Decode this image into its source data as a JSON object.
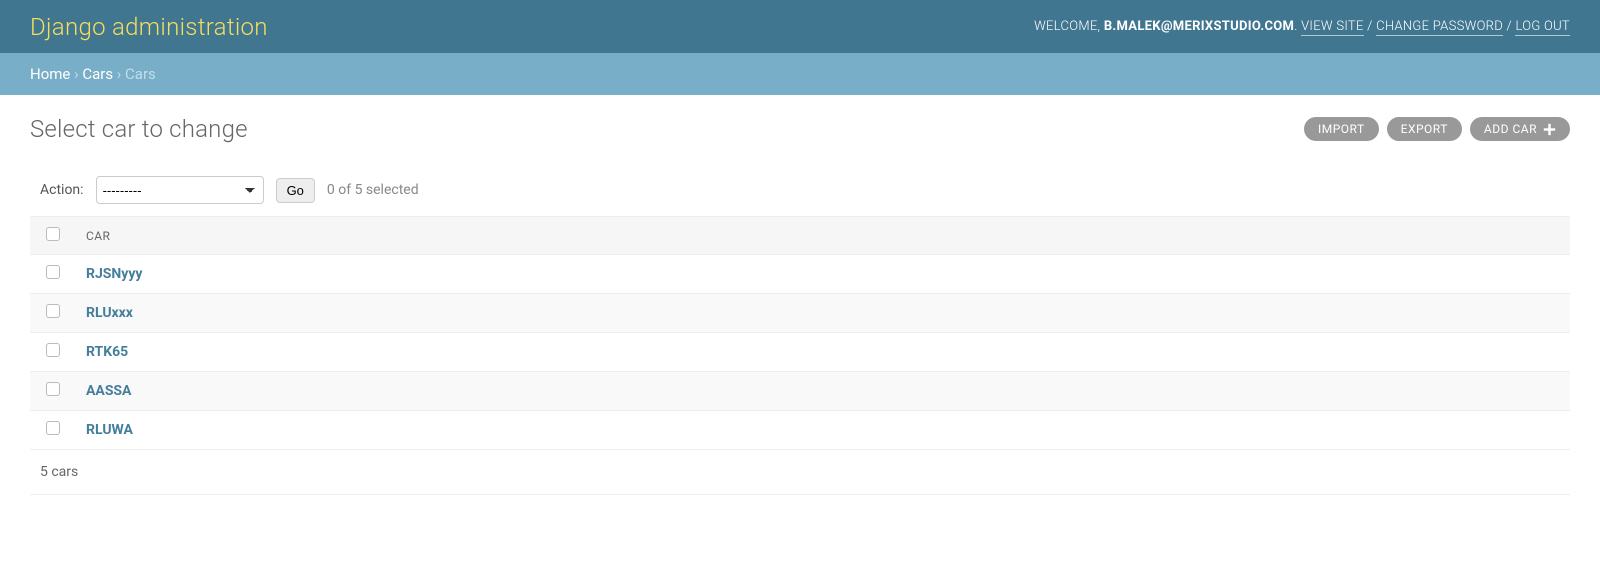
{
  "branding": "Django administration",
  "user_tools": {
    "welcome": "WELCOME,",
    "user": "B.MALEK@MERIXSTUDIO.COM",
    "view_site": "VIEW SITE",
    "change_password": "CHANGE PASSWORD",
    "log_out": "LOG OUT",
    "sep": " / ",
    "dot": ". "
  },
  "breadcrumbs": {
    "home": "Home",
    "app": "Cars",
    "model": "Cars",
    "sep": " › "
  },
  "page_title": "Select car to change",
  "object_tools": {
    "import": "IMPORT",
    "export": "EXPORT",
    "add": "ADD CAR"
  },
  "actions": {
    "label": "Action:",
    "placeholder": "---------",
    "go": "Go",
    "counter": "0 of 5 selected"
  },
  "table": {
    "header_col": "CAR",
    "rows": [
      {
        "name": "RJSNyyy"
      },
      {
        "name": "RLUxxx"
      },
      {
        "name": "RTK65"
      },
      {
        "name": "AASSA"
      },
      {
        "name": "RLUWA"
      }
    ]
  },
  "paginator": "5 cars"
}
